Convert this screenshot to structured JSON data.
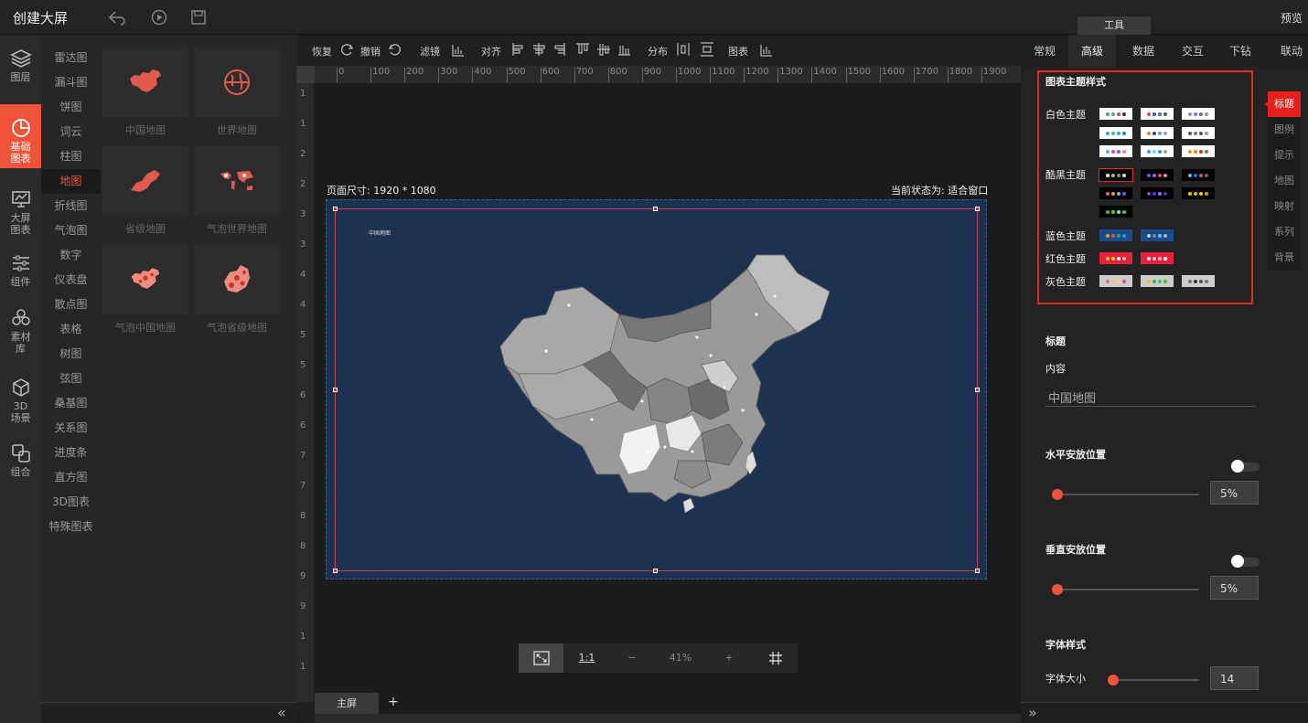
{
  "header": {
    "title": "创建大屏",
    "preview": "预览",
    "tools_tab": "工具"
  },
  "leftnav": [
    {
      "label": "图层",
      "icon": "layers-icon"
    },
    {
      "label": "基础\n图表",
      "icon": "pie-chart-icon",
      "active": true
    },
    {
      "label": "大屏\n图表",
      "icon": "screen-chart-icon"
    },
    {
      "label": "组件",
      "icon": "sliders-icon"
    },
    {
      "label": "素材\n库",
      "icon": "hexagons-icon"
    },
    {
      "label": "3D\n场景",
      "icon": "cube-icon"
    },
    {
      "label": "组合",
      "icon": "combine-icon"
    }
  ],
  "categories": [
    "雷达图",
    "漏斗图",
    "饼图",
    "词云",
    "柱图",
    "地图",
    "折线图",
    "气泡图",
    "数字",
    "仪表盘",
    "散点图",
    "表格",
    "树图",
    "弦图",
    "桑基图",
    "关系图",
    "进度条",
    "直方图",
    "3D图表",
    "特殊图表"
  ],
  "active_category": "地图",
  "thumbnails": [
    {
      "label": "中国地图"
    },
    {
      "label": "世界地图"
    },
    {
      "label": "省级地图"
    },
    {
      "label": "气泡世界地图"
    },
    {
      "label": "气泡中国地图"
    },
    {
      "label": "气泡省级地图"
    }
  ],
  "toolbar": {
    "redo": "恢复",
    "undo": "撤销",
    "filter": "滤镜",
    "align": "对齐",
    "distribute": "分布",
    "chart": "图表"
  },
  "ruler": {
    "marks": [
      "0",
      "100",
      "200",
      "300",
      "400",
      "500",
      "600",
      "700",
      "800",
      "900",
      "1000",
      "1100",
      "1200",
      "1300",
      "1400",
      "1500",
      "1600",
      "1700",
      "1800",
      "1900"
    ],
    "vmarks": [
      "1",
      "1",
      "2",
      "2",
      "3",
      "3",
      "4",
      "4",
      "5",
      "5",
      "6",
      "6",
      "7",
      "7",
      "8",
      "8",
      "9",
      "9",
      "1",
      "1"
    ]
  },
  "canvas": {
    "page_size": "页面尺寸: 1920 * 1080",
    "current_state": "当前状态为: 适合窗口",
    "map_title": "中国地图",
    "background": "#1e3150"
  },
  "zoom": {
    "ratio_label": "1:1",
    "minus": "−",
    "value": "41%",
    "plus": "+"
  },
  "pages": {
    "main": "主屏",
    "add": "+"
  },
  "right": {
    "tabs": [
      "常规",
      "高级",
      "数据",
      "交互",
      "下钻",
      "联动"
    ],
    "active_tab": "高级",
    "theme_section": "图表主题样式",
    "themes": [
      {
        "label": "白色主题",
        "rows": [
          [
            [
              "#fff",
              [
                "#4a90d9",
                "#5ab25a",
                "#9b59b6",
                "#333"
              ]
            ],
            [
              "#fff",
              [
                "#e74c3c",
                "#4a4a9a",
                "#3a6bd4",
                "#555"
              ]
            ],
            [
              "#fff",
              [
                "#8e8ec6",
                "#7b7bc6",
                "#6a6ab6",
                "#999"
              ]
            ]
          ],
          [
            [
              "#fff",
              [
                "#3a9bd9",
                "#2ecc71",
                "#3aa0d9",
                "#2980b9"
              ]
            ],
            [
              "#fff",
              [
                "#e67e22",
                "#34495e",
                "#5b9bd5",
                "#95a5a6"
              ]
            ],
            [
              "#fff",
              [
                "#555",
                "#777",
                "#555",
                "#999"
              ]
            ]
          ],
          [
            [
              "#fff",
              [
                "#5aa9e6",
                "#e84393",
                "#6c5ce7",
                "#fd79a8"
              ]
            ],
            [
              "#fff",
              [
                "#3498db",
                "#7ed6df",
                "#2d98da",
                "#95a5a6"
              ]
            ],
            [
              "#fff",
              [
                "#d4a017",
                "#e67e22",
                "#c0392b",
                "#8e6e3e"
              ]
            ]
          ]
        ]
      },
      {
        "label": "酷黑主题",
        "rows": [
          [
            [
              "#000",
              [
                "#f5f5f5",
                "#aaa",
                "#888",
                "#ddd"
              ]
            ],
            [
              "#000",
              [
                "#6c5ce7",
                "#a55eea",
                "#e84393",
                "#fd79a8"
              ]
            ],
            [
              "#000",
              [
                "#74b9ff",
                "#0984e3",
                "#e84393",
                "#636e72"
              ]
            ]
          ],
          [
            [
              "#000",
              [
                "#e17055",
                "#f39c12",
                "#a29bfe",
                "#6c5ce7"
              ]
            ],
            [
              "#000",
              [
                "#8e44ad",
                "#3742fa",
                "#a55eea",
                "#4834d4"
              ]
            ],
            [
              "#000",
              [
                "#f1c40f",
                "#e1b12c",
                "#fbc531",
                "#d4a017"
              ]
            ]
          ],
          [
            [
              "#000",
              [
                "#44bd32",
                "#4cd137",
                "#7bed9f",
                "#2ed573"
              ]
            ]
          ]
        ]
      },
      {
        "label": "蓝色主题",
        "rows": [
          [
            [
              "#1a4b8c",
              [
                "#f39c12",
                "#e74c3c",
                "#27ae60",
                "#3498db"
              ]
            ],
            [
              "#1a4b8c",
              [
                "#ccc",
                "#888",
                "#74b9ff",
                "#a5b1c2"
              ]
            ]
          ]
        ]
      },
      {
        "label": "红色主题",
        "rows": [
          [
            [
              "#e8203c",
              [
                "#fbc531",
                "#ffd32a",
                "#fff",
                "#ffb8b8"
              ]
            ],
            [
              "#e8203c",
              [
                "#fff",
                "#ffd1dc",
                "#fab1a0",
                "#fff"
              ]
            ]
          ]
        ]
      },
      {
        "label": "灰色主题",
        "rows": [
          [
            [
              "#ccc",
              [
                "#e17055",
                "#fab1a0",
                "#fdcb6e",
                "#e84393"
              ]
            ],
            [
              "#ccc",
              [
                "#f1c40f",
                "#27ae60",
                "#2ecc71",
                "#44bd32"
              ]
            ],
            [
              "#ccc",
              [
                "#636e72",
                "#2d3436",
                "#555",
                "#777"
              ]
            ]
          ]
        ]
      }
    ],
    "side_tabs": [
      "标题",
      "图例",
      "提示",
      "地图",
      "映射",
      "系列",
      "背景"
    ],
    "active_side": "标题",
    "title_section": "标题",
    "content_label": "内容",
    "content_value": "中国地图",
    "h_pos_label": "水平安放位置",
    "h_pos_value": "5%",
    "v_pos_label": "垂直安放位置",
    "v_pos_value": "5%",
    "font_section": "字体样式",
    "font_size_label": "字体大小",
    "font_size_value": "14"
  }
}
